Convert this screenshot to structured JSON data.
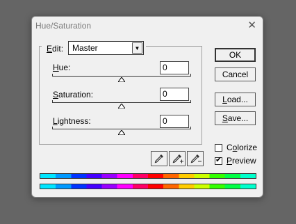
{
  "dialog": {
    "title": "Hue/Saturation"
  },
  "edit": {
    "label": "Edit:",
    "mnemonic": "E",
    "label_rest": "dit:",
    "selected": "Master"
  },
  "sliders": [
    {
      "label_mnemonic": "H",
      "label_rest": "ue:",
      "value": "0",
      "level": 0.5
    },
    {
      "label_mnemonic": "S",
      "label_rest": "aturation:",
      "value": "0",
      "level": 0.5
    },
    {
      "label_mnemonic": "L",
      "label_rest": "ightness:",
      "value": "0",
      "level": 0.5
    }
  ],
  "buttons": {
    "ok": "OK",
    "cancel": "Cancel",
    "load_mnemonic": "L",
    "load_rest": "oad...",
    "save_mnemonic": "S",
    "save_rest": "ave..."
  },
  "checkboxes": {
    "colorize": {
      "mnemonic": "o",
      "pre": "C",
      "rest": "lorize",
      "checked": false
    },
    "preview": {
      "mnemonic": "P",
      "rest": "review",
      "checked": true
    }
  },
  "icons": [
    "eyedropper-icon",
    "eyedropper-plus-icon",
    "eyedropper-minus-icon"
  ],
  "spectrum_colors": [
    "#00e5ff",
    "#0099ff",
    "#0033ff",
    "#4400ff",
    "#9900ff",
    "#ff00ff",
    "#ff0066",
    "#ff0000",
    "#ff6600",
    "#ffcc00",
    "#ccff00",
    "#33ff00",
    "#00ff44",
    "#00ffcc",
    "#00e5ff"
  ]
}
